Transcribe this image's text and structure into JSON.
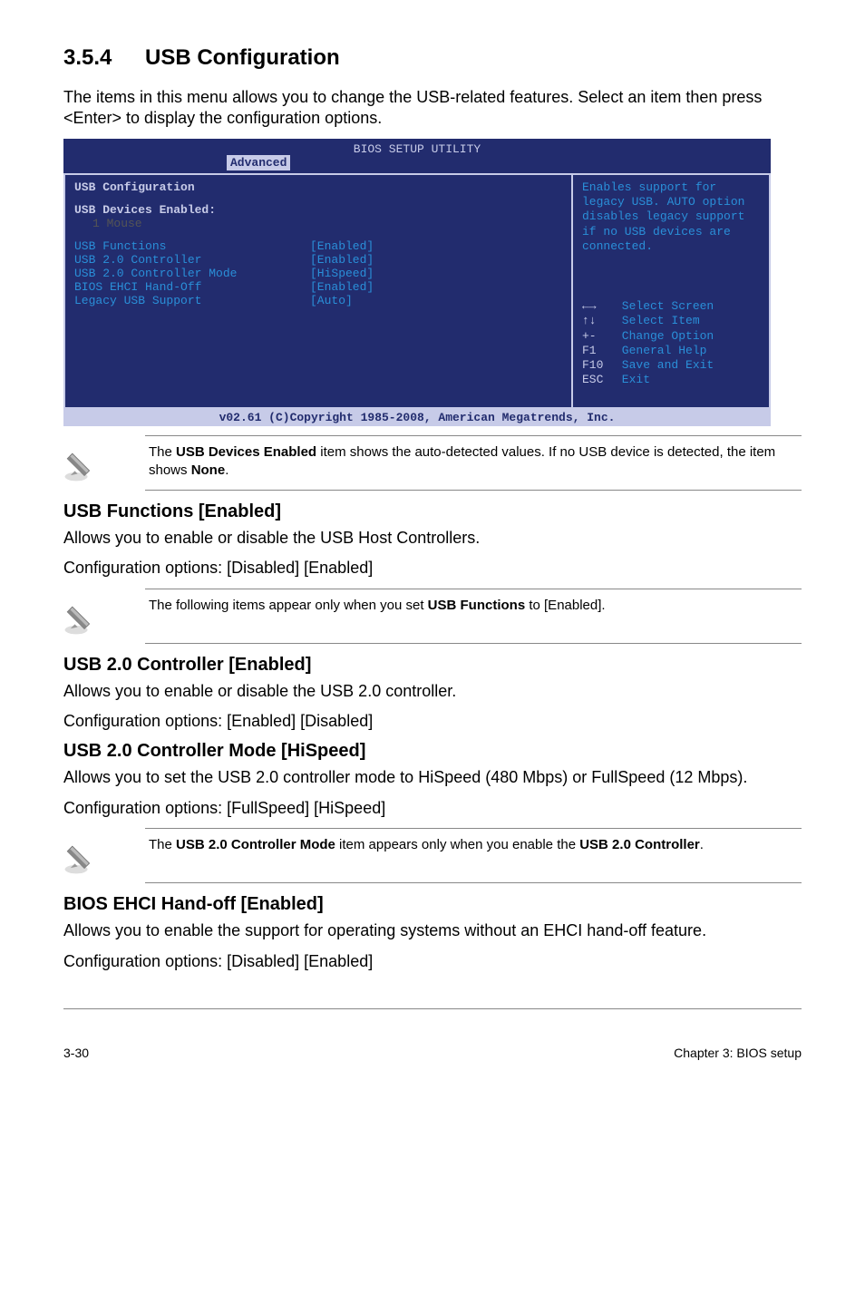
{
  "heading": {
    "number": "3.5.4",
    "title": "USB Configuration"
  },
  "intro": "The items in this menu allows you to change the USB-related features. Select an item then press <Enter> to display the configuration options.",
  "bios": {
    "title": "BIOS SETUP UTILITY",
    "active_tab": "Advanced",
    "panel_header": "USB Configuration",
    "devices_label": "USB Devices Enabled:",
    "devices_value": "1 Mouse",
    "settings": [
      {
        "label": "USB Functions",
        "value": "[Enabled]"
      },
      {
        "label": "USB 2.0 Controller",
        "value": "[Enabled]"
      },
      {
        "label": "USB 2.0 Controller Mode",
        "value": "[HiSpeed]"
      },
      {
        "label": "BIOS EHCI Hand-Off",
        "value": "[Enabled]"
      },
      {
        "label": "Legacy USB Support",
        "value": "[Auto]"
      }
    ],
    "help_text": "Enables support for legacy USB. AUTO option disables legacy support if no USB devices are connected.",
    "nav": [
      {
        "key": "←→",
        "label": "Select Screen"
      },
      {
        "key": "↑↓",
        "label": "Select Item"
      },
      {
        "key": "+-",
        "label": "Change Option"
      },
      {
        "key": "F1",
        "label": "General Help"
      },
      {
        "key": "F10",
        "label": "Save and Exit"
      },
      {
        "key": "ESC",
        "label": "Exit"
      }
    ],
    "footer": "v02.61 (C)Copyright 1985-2008, American Megatrends, Inc."
  },
  "note1": {
    "text_html": "The <b>USB Devices Enabled</b> item shows the auto-detected values. If no USB device is detected, the item shows <b>None</b>."
  },
  "sections": [
    {
      "heading": "USB Functions [Enabled]",
      "body": "Allows you to enable or disable the USB Host Controllers.\nConfiguration options: [Disabled] [Enabled]",
      "note_html": "The following items appear only when you set <b>USB Functions</b> to [Enabled]."
    },
    {
      "heading": "USB 2.0 Controller [Enabled]",
      "body": "Allows you to enable or disable the USB 2.0 controller.\nConfiguration options: [Enabled] [Disabled]"
    },
    {
      "heading": "USB 2.0 Controller Mode [HiSpeed]",
      "body": "Allows you to set the USB 2.0 controller mode to HiSpeed (480 Mbps) or FullSpeed (12 Mbps).\nConfiguration options: [FullSpeed] [HiSpeed]",
      "note_html": "The <b>USB 2.0 Controller Mode</b> item appears only when you enable the <b>USB 2.0 Controller</b>."
    },
    {
      "heading": "BIOS EHCI Hand-off [Enabled]",
      "body": "Allows you to enable the support for operating systems without an EHCI hand-off feature.\nConfiguration options: [Disabled] [Enabled]"
    }
  ],
  "footer": {
    "left": "3-30",
    "right": "Chapter 3: BIOS setup"
  }
}
